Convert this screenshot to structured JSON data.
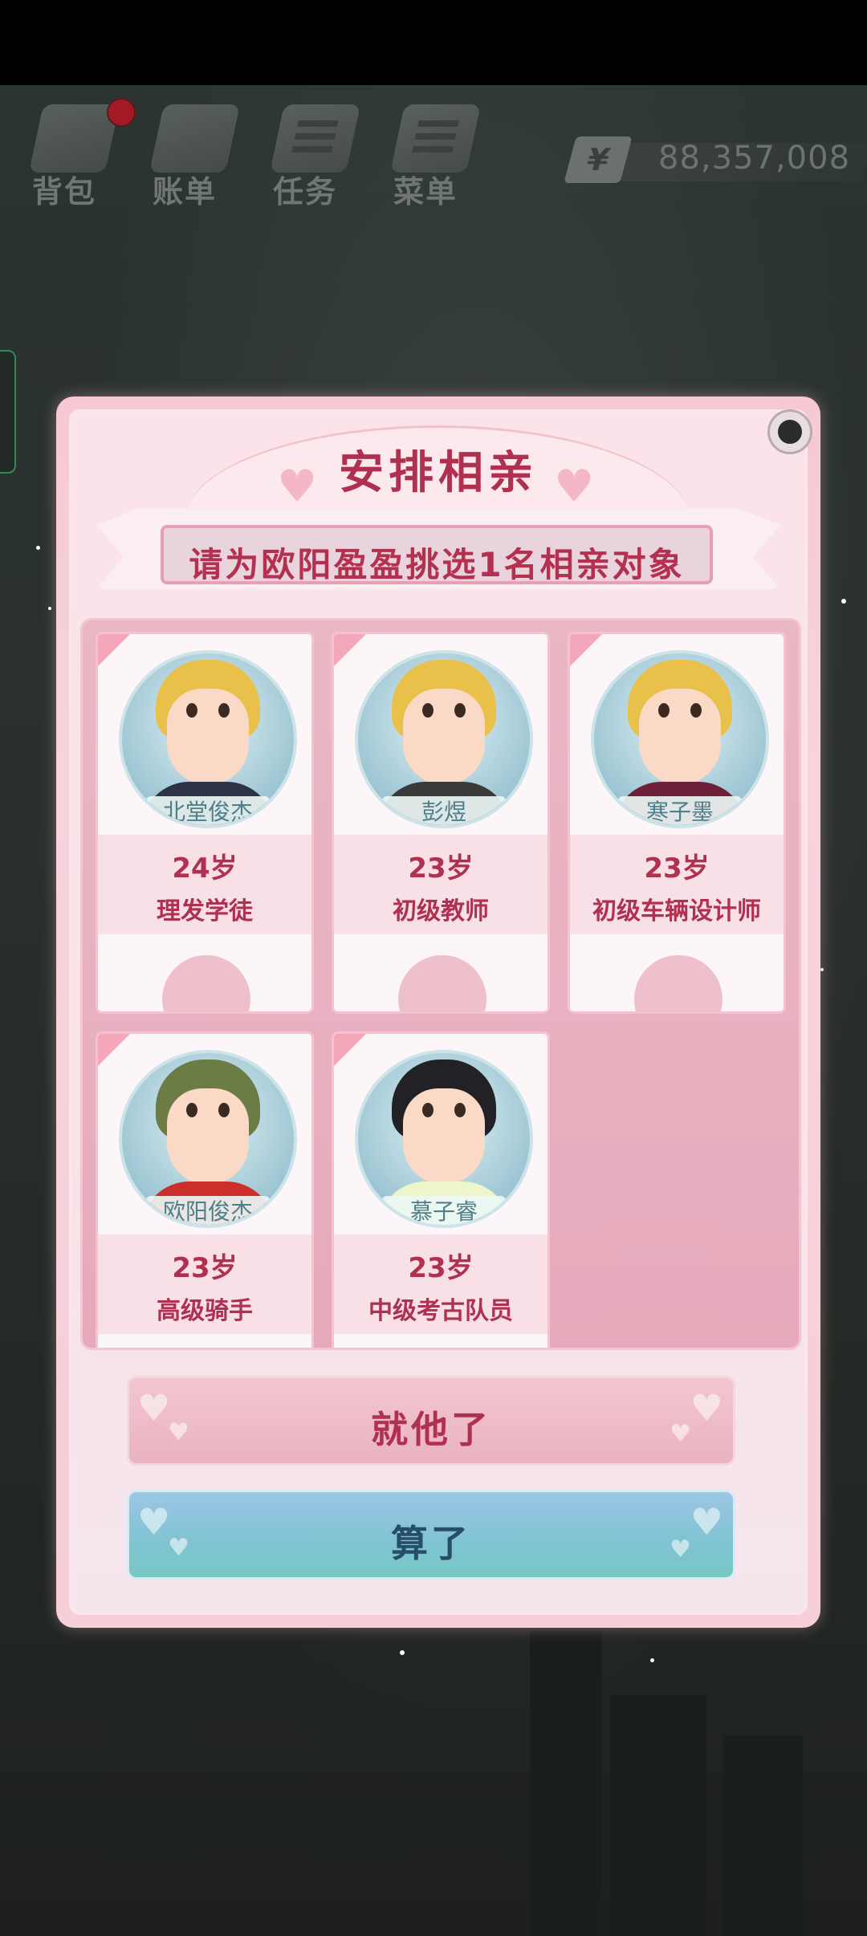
{
  "hud": {
    "items": [
      {
        "label": "背包",
        "icon": "backpack-icon"
      },
      {
        "label": "账单",
        "icon": "bill-icon"
      },
      {
        "label": "任务",
        "icon": "task-icon"
      },
      {
        "label": "菜单",
        "icon": "menu-icon"
      }
    ],
    "currency_symbol": "¥",
    "money": "88,357,008"
  },
  "dialog": {
    "title": "安排相亲",
    "subtitle": "请为欧阳盈盈挑选1名相亲对象",
    "candidates": [
      {
        "name": "北堂俊杰",
        "age": "24岁",
        "job": "理发学徒"
      },
      {
        "name": "彭煜",
        "age": "23岁",
        "job": "初级教师"
      },
      {
        "name": "寒子墨",
        "age": "23岁",
        "job": "初级车辆设计师"
      },
      {
        "name": "欧阳俊杰",
        "age": "23岁",
        "job": "高级骑手"
      },
      {
        "name": "慕子睿",
        "age": "23岁",
        "job": "中级考古队员"
      }
    ],
    "confirm_label": "就他了",
    "cancel_label": "算了"
  },
  "colors": {
    "accent": "#b0304f",
    "dialog_bg": "#f7d3dc",
    "cancel_button": "#7fc4d1"
  }
}
